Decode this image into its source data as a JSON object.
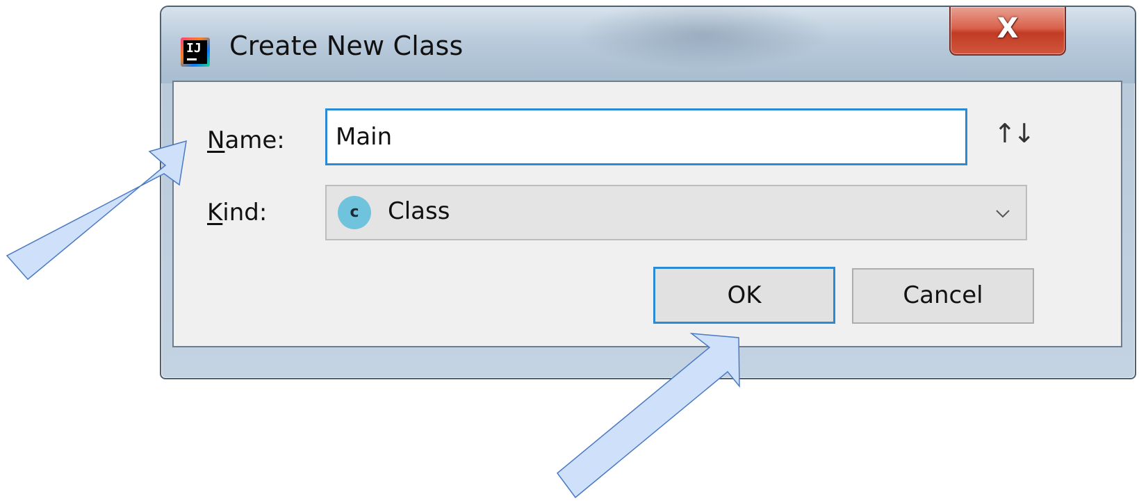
{
  "window": {
    "title": "Create New Class",
    "app_icon": "intellij-idea-icon",
    "app_icon_letters": "IJ",
    "close_glyph": "X"
  },
  "form": {
    "name_label": "Name:",
    "name_mnemonic": "N",
    "name_label_rest": "ame:",
    "name_value": "Main",
    "kind_label": "Kind:",
    "kind_mnemonic": "K",
    "kind_label_rest": "ind:",
    "kind_value": "Class",
    "kind_icon_letter": "c",
    "sort_icon_glyph": "↑↓"
  },
  "buttons": {
    "ok_label": "OK",
    "cancel_label": "Cancel"
  },
  "colors": {
    "focus_border": "#2a8ad4",
    "close_button": "#c13b24",
    "class_icon": "#6fc3dd",
    "annotation_arrow_fill": "#cfe0fb",
    "annotation_arrow_stroke": "#4a79c4"
  }
}
